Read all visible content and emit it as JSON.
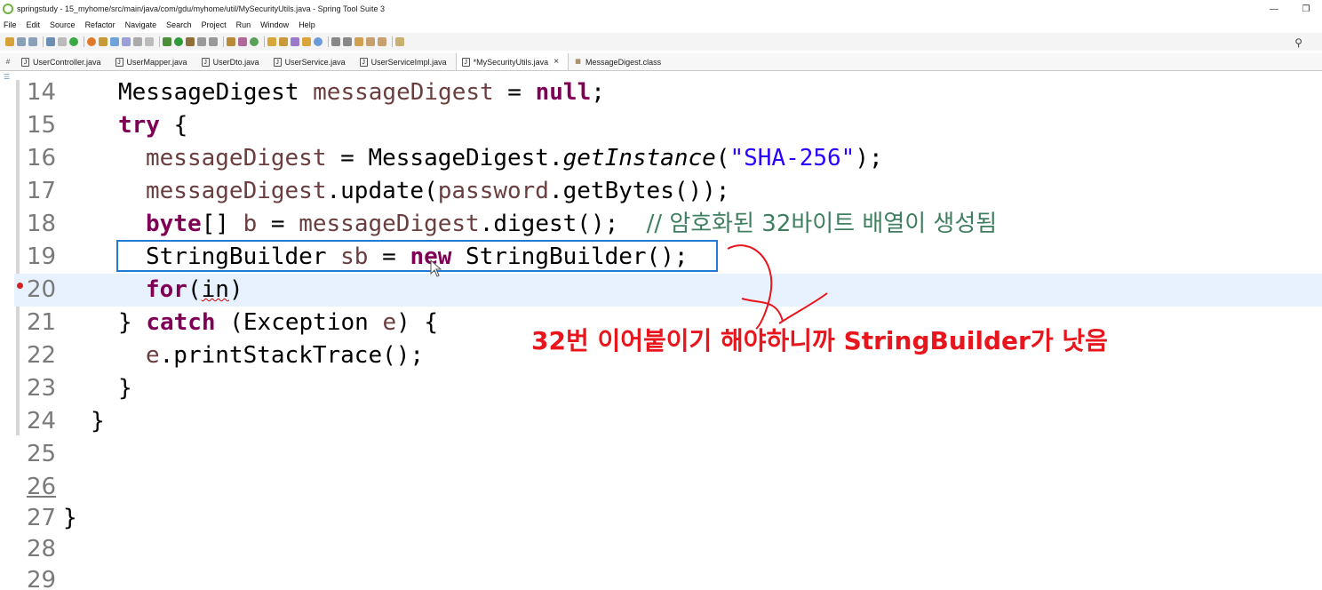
{
  "window": {
    "title": "springstudy - 15_myhome/src/main/java/com/gdu/myhome/util/MySecurityUtils.java - Spring Tool Suite 3",
    "min_label": "—",
    "max_label": "❐"
  },
  "menu": [
    "File",
    "Edit",
    "Source",
    "Refactor",
    "Navigate",
    "Search",
    "Project",
    "Run",
    "Window",
    "Help"
  ],
  "tabs": [
    {
      "label": "UserController.java",
      "active": false
    },
    {
      "label": "UserMapper.java",
      "active": false
    },
    {
      "label": "UserDto.java",
      "active": false
    },
    {
      "label": "UserService.java",
      "active": false
    },
    {
      "label": "UserServiceImpl.java",
      "active": false
    },
    {
      "label": "*MySecurityUtils.java",
      "active": true
    },
    {
      "label": "MessageDigest.class",
      "active": false
    }
  ],
  "tab_close_label": "×",
  "editor": {
    "line_numbers": [
      "14",
      "15",
      "16",
      "17",
      "18",
      "19",
      "20",
      "21",
      "22",
      "23",
      "24",
      "25",
      "26",
      "27",
      "28",
      "29"
    ],
    "line14": {
      "type": "MessageDigest",
      "var": "messageDigest",
      "rest": " = ",
      "kw": "null",
      "end": ";"
    },
    "line15": {
      "kw": "try",
      "rest": " {"
    },
    "line16": {
      "var": "messageDigest",
      "rest1": " = MessageDigest.",
      "method": "getInstance",
      "rest2": "(",
      "str": "\"SHA-256\"",
      "end": ");"
    },
    "line17": {
      "var1": "messageDigest",
      "rest1": ".update(",
      "var2": "password",
      "end": ".getBytes());"
    },
    "line18": {
      "kw": "byte",
      "rest1": "[] ",
      "var1": "b",
      "rest2": " = ",
      "var2": "messageDigest",
      "rest3": ".digest();  ",
      "comment": "// 암호화된 32바이트 배열이 생성됨"
    },
    "line19": {
      "type": "StringBuilder ",
      "var": "sb",
      "rest1": " = ",
      "kw": "new",
      "rest2": " StringBuilder();"
    },
    "line20": {
      "kw": "for",
      "rest1": "(",
      "err": "in",
      "end": ")"
    },
    "line21": {
      "pre": "} ",
      "kw": "catch",
      "rest1": " (Exception ",
      "var": "e",
      "end": ") {"
    },
    "line22": {
      "var": "e",
      "end": ".printStackTrace();"
    },
    "line23": {
      "text": "}"
    },
    "line24": {
      "text": "}"
    },
    "line27": {
      "text": "}"
    }
  },
  "annotation": "32번 이어붙이기 해야하니까 StringBuilder가 낫음",
  "colors": {
    "accent_box": "#1f7bd4",
    "annotation": "#e8151d",
    "keyword": "#7f0055",
    "string": "#2a00ff",
    "comment": "#3f7f5f"
  }
}
